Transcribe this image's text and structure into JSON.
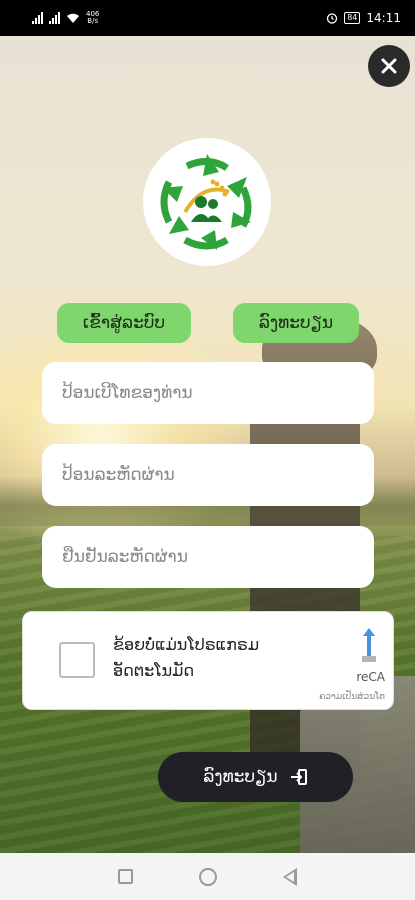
{
  "status_bar": {
    "net_speed_value": "406",
    "net_speed_unit": "B/s",
    "battery": "84",
    "time": "14:11",
    "icons": [
      "signal-icon",
      "signal-icon",
      "wifi-icon",
      "alarm-icon",
      "battery-icon"
    ]
  },
  "header": {
    "close_icon": "close-icon",
    "logo_icon": "app-logo"
  },
  "tabs": {
    "login_label": "ເຂົ້າສູ່ລະບົບ",
    "register_label": "ລົງທະບຽນ"
  },
  "form": {
    "phone_placeholder": "ປ້ອນເບີໂທຂອງທ່ານ",
    "password_placeholder": "ປ້ອນລະຫັດຜ່ານ",
    "confirm_placeholder": "ຢືນຢັນລະຫັດຜ່ານ"
  },
  "captcha": {
    "label_line1": "ຂ້ອຍບໍ່ແມ່ນໂປຣແກຣມ",
    "label_line2": "ອັດຕະໂນມັດ",
    "brand": "reCA",
    "privacy": "ຄວາມເປັນສ່ວນໂຕ"
  },
  "submit": {
    "label": "ລົງທະບຽນ",
    "icon": "sign-in-icon"
  },
  "nav": {
    "icons": [
      "recents-icon",
      "home-icon",
      "back-icon"
    ]
  },
  "colors": {
    "accent_green": "#7fd66c",
    "button_dark": "#1f2124"
  }
}
